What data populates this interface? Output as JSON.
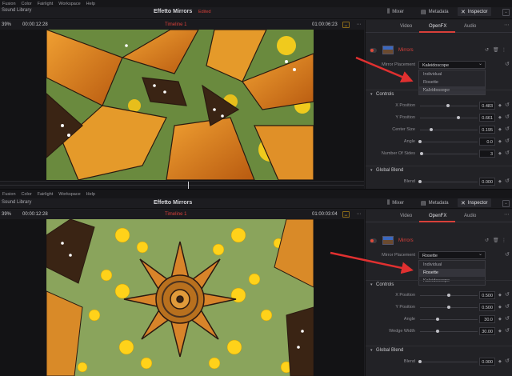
{
  "menu": [
    "Fusion",
    "Color",
    "Fairlight",
    "Workspace",
    "Help"
  ],
  "library_label": "Sound Library",
  "project_title": "Effetto Mirrors",
  "edited_label": "Edited",
  "toolbar": {
    "mixer": "Mixer",
    "metadata": "Metadata",
    "inspector": "Inspector"
  },
  "tabs": [
    "Video",
    "OpenFX",
    "Audio"
  ],
  "effect_name": "Mirrors",
  "placement_label": "Mirror Placement",
  "options": [
    "Individual",
    "Rosette",
    "Kaleidoscope"
  ],
  "controls_label": "Controls",
  "global_blend_label": "Global Blend",
  "blend_label": "Blend",
  "accent_color": "#d8403a",
  "top": {
    "zoom": "39%",
    "tc_left": "00:00:12:28",
    "timeline": "Timeline 1",
    "tc_right": "01:00:06:23",
    "placement": "Kaleidoscope",
    "highlighted": 2,
    "params": [
      {
        "label": "X Position",
        "value": "0.483"
      },
      {
        "label": "Y Position",
        "value": "0.661"
      },
      {
        "label": "Center Size",
        "value": "0.195"
      },
      {
        "label": "Angle",
        "value": "0.0"
      },
      {
        "label": "Number Of Sides",
        "value": "3"
      }
    ],
    "blend": "0.000"
  },
  "bottom": {
    "zoom": "39%",
    "tc_left": "00:00:12:28",
    "timeline": "Timeline 1",
    "tc_right": "01:00:03:04",
    "placement": "Rosette",
    "highlighted": 1,
    "params": [
      {
        "label": "X Position",
        "value": "0.500"
      },
      {
        "label": "Y Position",
        "value": "0.500"
      },
      {
        "label": "Angle",
        "value": "30.0"
      },
      {
        "label": "Wedge Width",
        "value": "30.00"
      }
    ],
    "blend": "0.000"
  }
}
